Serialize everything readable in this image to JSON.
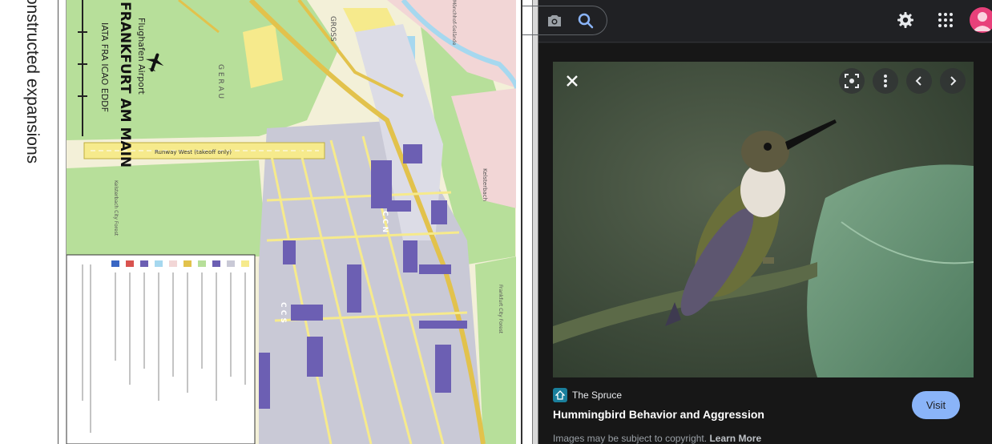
{
  "document": {
    "side_text": "onstructed expansions",
    "map": {
      "header_small": "Flughafen Airport",
      "header_title": "FRANKFURT AM MAIN",
      "codes": "IATA FRA   ICAO EDDF",
      "runway_label": "Runway West (takeoff only)",
      "labels": [
        "G E R A U",
        "GROSS",
        "Kelsterbach",
        "Mönchhof-Gelände",
        "C C N",
        "C C S",
        "Frankfurt City Forest",
        "Kelsterbach City Forest"
      ],
      "colors": {
        "forest": "#b7df9a",
        "urban": "#f2d6d6",
        "apron": "#c9c9d6",
        "terminal": "#6c5fb3",
        "runway": "#f6ea8c",
        "highway": "#e2c24c",
        "water": "#a6d8ef"
      }
    }
  },
  "google": {
    "topbar": {
      "camera_icon": "camera-icon",
      "search_icon": "search-icon",
      "settings_icon": "gear-icon",
      "apps_icon": "apps-grid-icon",
      "avatar_icon": "account-avatar"
    },
    "viewer": {
      "close_icon": "close-icon",
      "lens_icon": "google-lens-icon",
      "more_icon": "more-vert-icon",
      "prev_icon": "chevron-left-icon",
      "next_icon": "chevron-right-icon",
      "source_name": "The Spruce",
      "title": "Hummingbird Behavior and Aggression",
      "visit_label": "Visit",
      "copyright_text": "Images may be subject to copyright.",
      "learn_more_label": "Learn More"
    },
    "colors": {
      "accent": "#8ab4f8",
      "avatar": "#e8407a",
      "favicon": "#1a7f9c"
    }
  }
}
